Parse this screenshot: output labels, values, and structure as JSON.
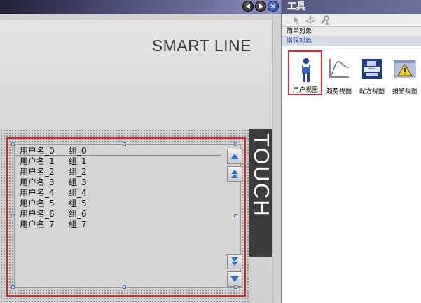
{
  "editor": {
    "panel_brand": "SMART LINE",
    "touch_label": "TOUCH",
    "user_view": {
      "rows": [
        {
          "user": "用户名_0",
          "group": "组_0"
        },
        {
          "user": "用户名_1",
          "group": "组_1"
        },
        {
          "user": "用户名_2",
          "group": "组_2"
        },
        {
          "user": "用户名_3",
          "group": "组_3"
        },
        {
          "user": "用户名_4",
          "group": "组_4"
        },
        {
          "user": "用户名_5",
          "group": "组_5"
        },
        {
          "user": "用户名_6",
          "group": "组_6"
        },
        {
          "user": "用户名_7",
          "group": "组_7"
        }
      ],
      "scroll_icons": [
        "scroll-up-icon",
        "page-up-icon",
        "page-down-icon",
        "scroll-down-icon"
      ]
    },
    "window_icons": [
      "back-icon",
      "forward-icon",
      "close-icon"
    ]
  },
  "tools": {
    "title": "工具",
    "toolbar_icons": [
      "pointer-icon",
      "anchor-icon",
      "wrench-icon"
    ],
    "categories": {
      "simple": "简单对象",
      "enhanced": "增强对象"
    },
    "items": [
      {
        "label": "用户视图",
        "icon": "user-view-icon"
      },
      {
        "label": "趋势视图",
        "icon": "trend-view-icon"
      },
      {
        "label": "配方视图",
        "icon": "recipe-view-icon"
      },
      {
        "label": "报警视图",
        "icon": "alarm-view-icon"
      }
    ],
    "colors": {
      "selection_outline": "#e0242c",
      "titlebar": "#55587e",
      "enhanced_category_text": "#1f3fa8"
    }
  }
}
